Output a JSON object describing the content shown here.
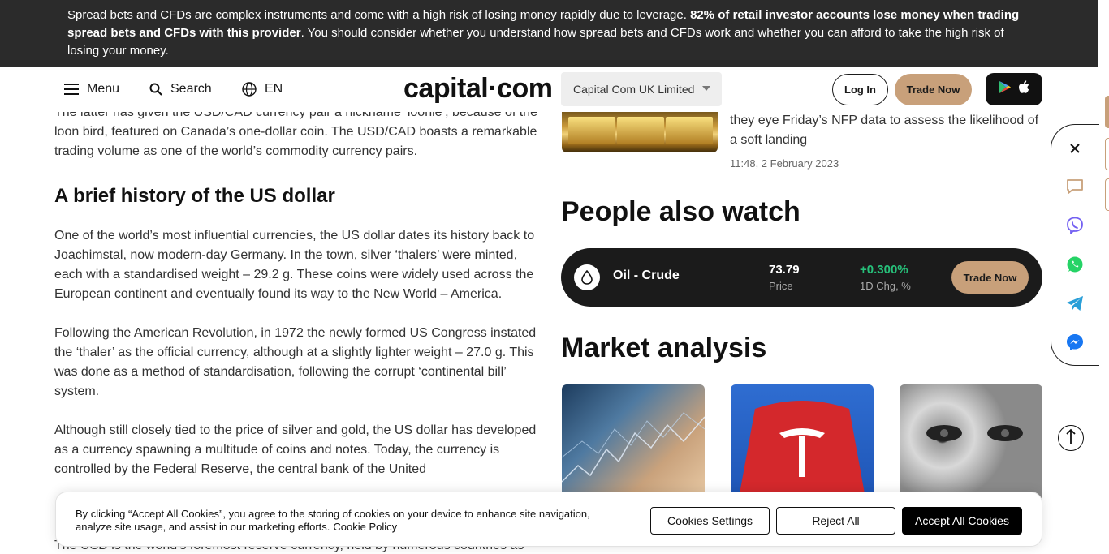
{
  "risk_banner": {
    "text_before": "Spread bets and CFDs are complex instruments and come with a high risk of losing money rapidly due to leverage. ",
    "text_bold": "82% of retail investor accounts lose money when trading spread bets and CFDs with this provider",
    "text_after": ". You should consider whether you understand how spread bets and CFDs work and whether you can afford to take the high risk of losing your money."
  },
  "header": {
    "menu_label": "Menu",
    "search_label": "Search",
    "language": "EN",
    "logo": "capital·com",
    "entity_selected": "Capital Com UK Limited",
    "login_label": "Log In",
    "trade_label": "Trade Now"
  },
  "article": {
    "para_intro": "The latter has given the USD/CAD currency pair a nickname ‘loonie’, because of the loon bird, featured on Canada’s one-dollar coin. The USD/CAD boasts a remarkable trading volume as one of the world’s commodity currency pairs.",
    "heading": "A brief history of the US dollar",
    "para1": "One of the world’s most influential currencies, the US dollar dates its history back to Joachimstal, now modern-day Germany. In the town, silver ‘thalers’ were minted, each with a standardised weight – 29.2 g. These coins were widely used across the European continent and eventually found its way to the New World – America.",
    "para2": "Following the American Revolution, in 1972 the newly formed US Congress instated the ‘thaler’ as the official currency, although at a slightly lighter weight – 27.0 g. This was done as a method of standardisation, following the corrupt ‘continental bill’ system.",
    "para3": "Although still closely tied to the price of silver and gold, the US dollar has developed as a currency spawning a multitude of coins and notes. Today, the currency is controlled by the Federal Reserve, the central bank of the United",
    "para4_partial": "The USD is the world’s foremost reserve currency, held by numerous countries as"
  },
  "news": {
    "text": "they eye Friday’s NFP data to assess the likelihood of a soft landing",
    "time": "11:48, 2 February 2023"
  },
  "people_also_watch": {
    "heading": "People also watch",
    "item": {
      "name": "Oil - Crude",
      "price": "73.79",
      "price_label": "Price",
      "change": "+0.300%",
      "change_label": "1D Chg, %",
      "button": "Trade Now"
    }
  },
  "market_analysis": {
    "heading": "Market analysis"
  },
  "cookie": {
    "text": "By clicking “Accept All Cookies”, you agree to the storing of cookies on your device to enhance site navigation, analyze site usage, and assist in our marketing efforts.",
    "policy_link": "Cookie Policy",
    "settings_label": "Cookies Settings",
    "reject_label": "Reject All",
    "accept_label": "Accept All Cookies"
  },
  "colors": {
    "accent": "#c8a07a",
    "positive": "#27c07a",
    "dark": "#1b1b1b"
  },
  "icons": [
    "menu-icon",
    "search-icon",
    "globe-icon",
    "google-play-icon",
    "apple-icon",
    "close-icon",
    "chat-icon",
    "viber-icon",
    "whatsapp-icon",
    "telegram-icon",
    "messenger-icon",
    "arrow-up-icon",
    "drop-icon"
  ]
}
